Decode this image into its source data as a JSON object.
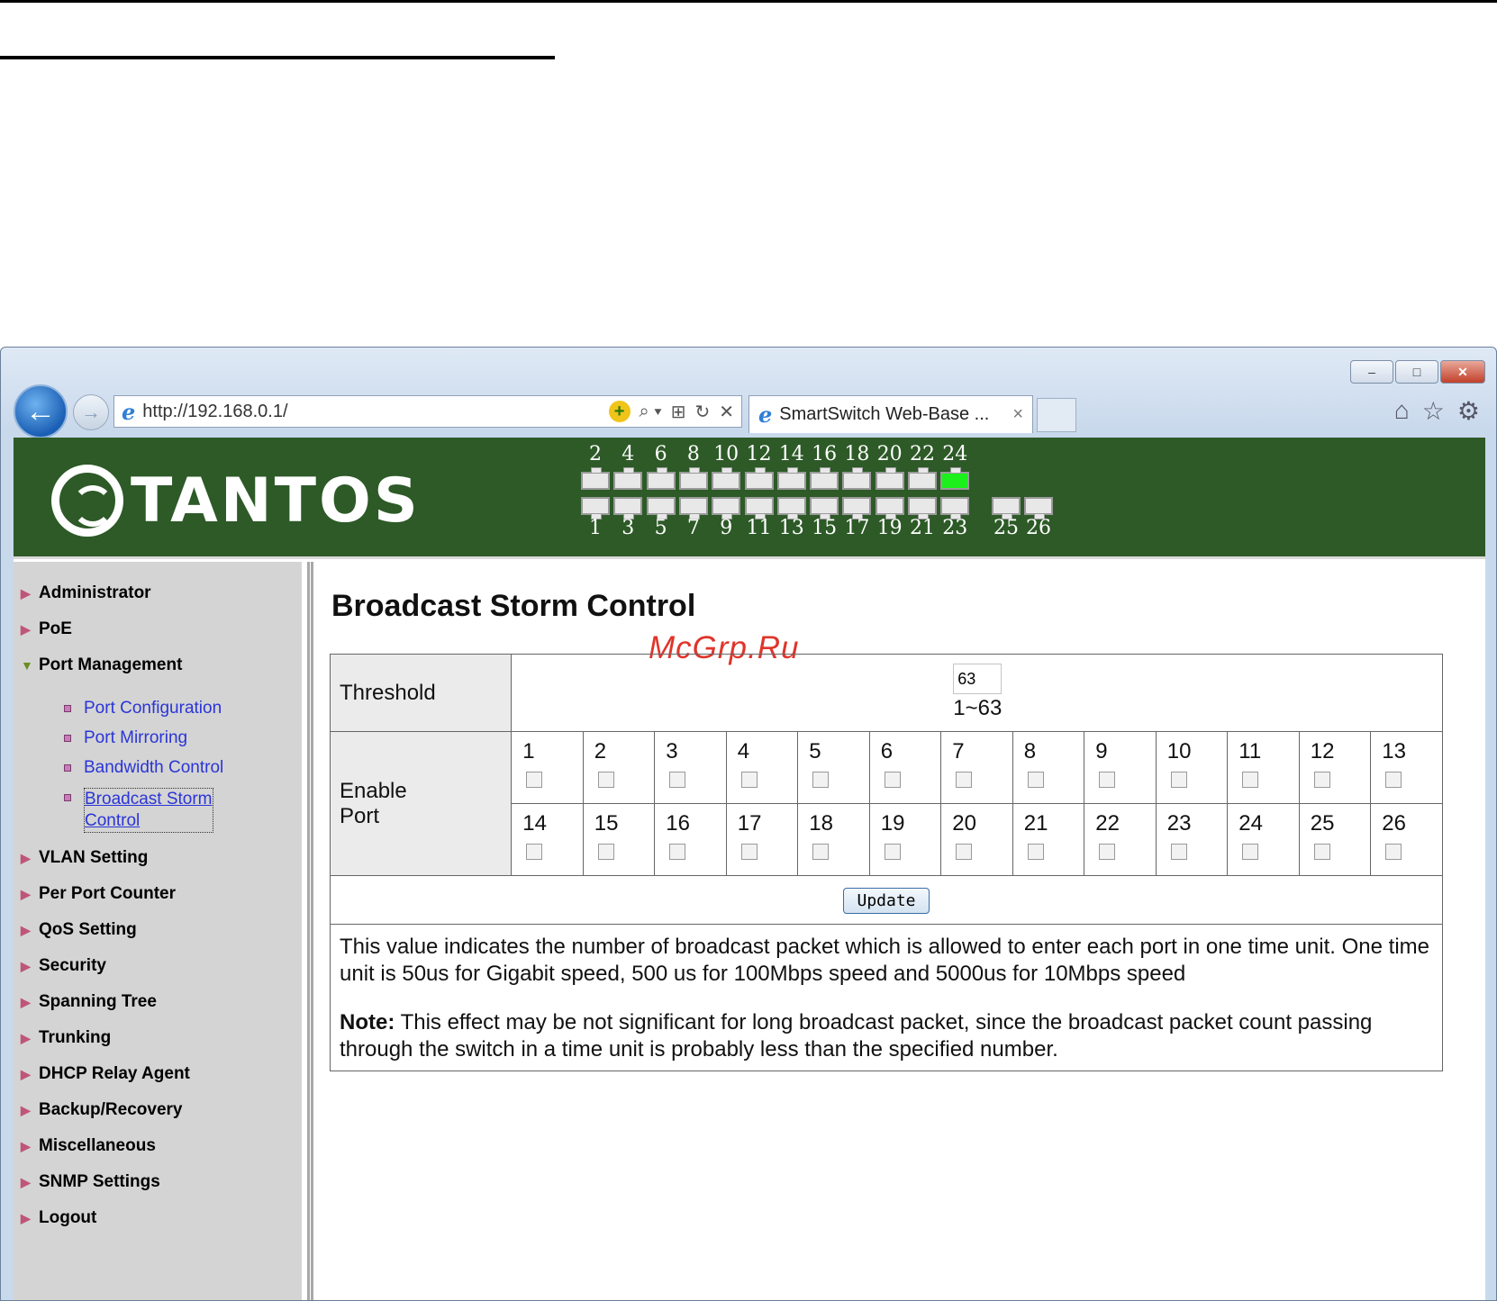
{
  "browser": {
    "url": "http://192.168.0.1/",
    "tab_title": "SmartSwitch Web-Base ...",
    "tab_close": "×",
    "minimize": "–",
    "restore": "□",
    "close": "✕",
    "back": "←",
    "forward": "→",
    "compat_glyph": "+",
    "search_glyph": "⌕ ▾",
    "compat_view_glyph": "⊞",
    "refresh_glyph": "↻",
    "stop_glyph": "✕",
    "home_glyph": "⌂",
    "favorites_glyph": "☆",
    "tools_glyph": "⚙"
  },
  "banner": {
    "logo_text": "TANTOS",
    "top_ports": [
      "2",
      "4",
      "6",
      "8",
      "10",
      "12",
      "14",
      "16",
      "18",
      "20",
      "22",
      "24"
    ],
    "bottom_ports": [
      "1",
      "3",
      "5",
      "7",
      "9",
      "11",
      "13",
      "15",
      "17",
      "19",
      "21",
      "23"
    ],
    "extra_ports": [
      "25",
      "26"
    ],
    "active_port": "24"
  },
  "sidebar": {
    "items": [
      {
        "label": "Administrator"
      },
      {
        "label": "PoE"
      },
      {
        "label": "Port Management"
      },
      {
        "label": "VLAN Setting"
      },
      {
        "label": "Per Port Counter"
      },
      {
        "label": "QoS Setting"
      },
      {
        "label": "Security"
      },
      {
        "label": "Spanning Tree"
      },
      {
        "label": "Trunking"
      },
      {
        "label": "DHCP Relay Agent"
      },
      {
        "label": "Backup/Recovery"
      },
      {
        "label": "Miscellaneous"
      },
      {
        "label": "SNMP Settings"
      },
      {
        "label": "Logout"
      }
    ],
    "sub_items": [
      {
        "label": "Port Configuration"
      },
      {
        "label": "Port Mirroring"
      },
      {
        "label": "Bandwidth Control"
      },
      {
        "label": "Broadcast Storm",
        "label2": "Control"
      }
    ]
  },
  "main": {
    "title": "Broadcast Storm Control",
    "watermark": "McGrp.Ru",
    "threshold_label": "Threshold",
    "threshold_value": "63",
    "threshold_range": "1~63",
    "enable_label_1": "Enable",
    "enable_label_2": "Port",
    "ports_row1": [
      "1",
      "2",
      "3",
      "4",
      "5",
      "6",
      "7",
      "8",
      "9",
      "10",
      "11",
      "12",
      "13"
    ],
    "ports_row2": [
      "14",
      "15",
      "16",
      "17",
      "18",
      "19",
      "20",
      "21",
      "22",
      "23",
      "24",
      "25",
      "26"
    ],
    "update_label": "Update",
    "description": "This value indicates the number of broadcast packet which is allowed to enter each port in one time unit. One time unit is 50us for Gigabit speed, 500 us for 100Mbps speed and 5000us for 10Mbps speed",
    "note_label": "Note:",
    "note_text": " This effect may be not significant for long broadcast packet, since the broadcast packet count passing through the switch in a time unit is probably less than the specified number."
  }
}
